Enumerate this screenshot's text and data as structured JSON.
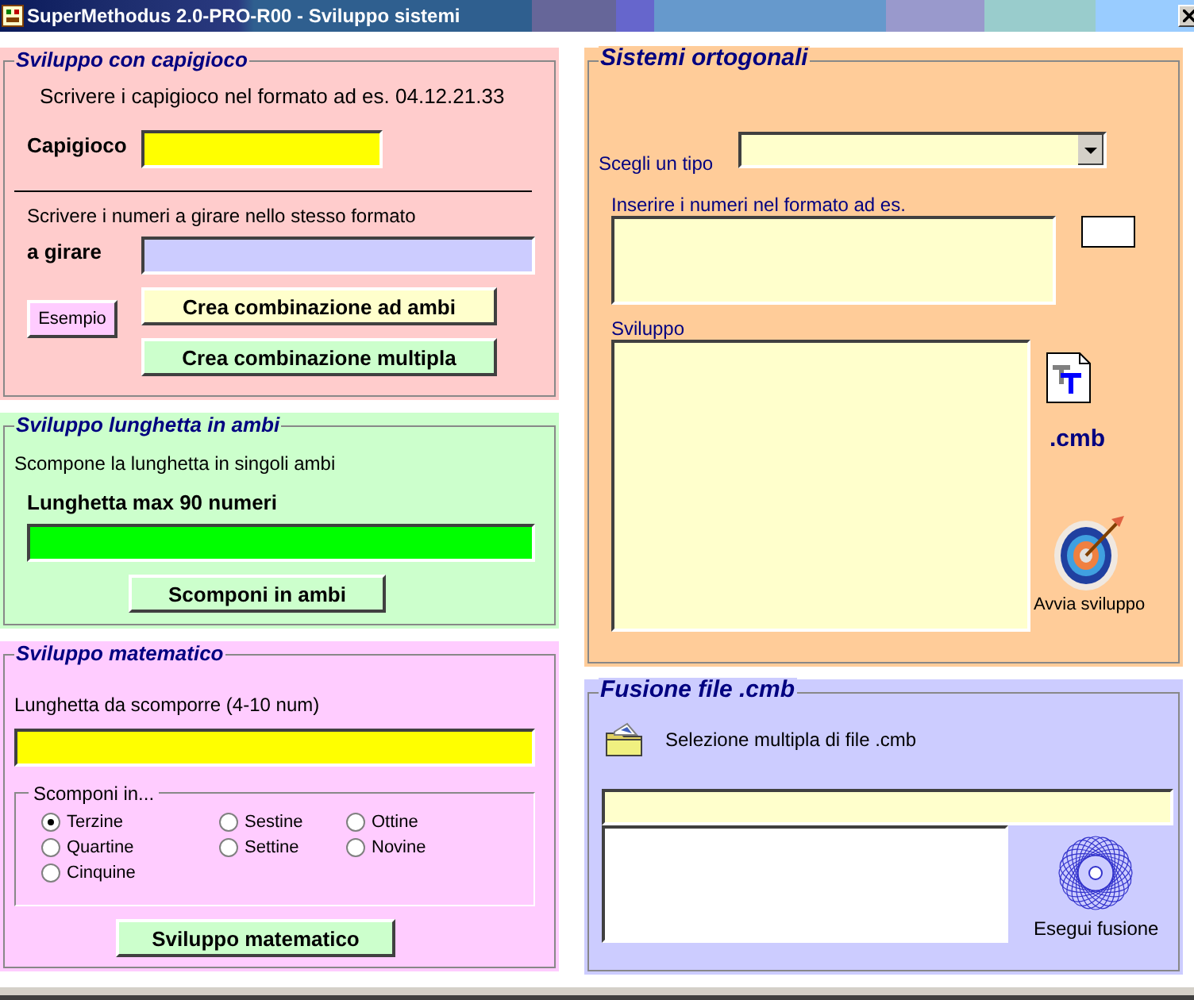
{
  "window": {
    "title": "SuperMethodus 2.0-PRO-R00 - Sviluppo sistemi"
  },
  "capigioco": {
    "title": "Sviluppo con capigioco",
    "instruction": "Scrivere i capigioco nel formato ad es. 04.12.21.33",
    "capigioco_label": "Capigioco",
    "numbers_instruction": "Scrivere i numeri a girare nello stesso formato",
    "numbers_label": "a girare",
    "example_button": "Esempio",
    "ambi_button": "Crea combinazione ad ambi",
    "multipla_button": "Crea combinazione multipla"
  },
  "lunghetta": {
    "title": "Sviluppo lunghetta in ambi",
    "description": "Scompone la lunghetta in singoli ambi",
    "max_label": "Lunghetta max 90 numeri",
    "button": "Scomponi in ambi"
  },
  "matematico": {
    "title": "Sviluppo matematico",
    "length_label": "Lunghetta da scomporre (4-10 num)",
    "group_title": "Scomponi in...",
    "option_columns": [
      [
        {
          "label": "Terzine",
          "selected": true
        },
        {
          "label": "Quartine",
          "selected": false
        },
        {
          "label": "Cinquine",
          "selected": false
        }
      ],
      [
        {
          "label": "Sestine",
          "selected": false
        },
        {
          "label": "Settine",
          "selected": false
        }
      ],
      [
        {
          "label": "Ottine",
          "selected": false
        },
        {
          "label": "Novine",
          "selected": false
        }
      ]
    ],
    "button": "Sviluppo matematico"
  },
  "ortogonali": {
    "title": "Sistemi ortogonali",
    "type_label": "Scegli un tipo",
    "numbers_label": "Inserire i numeri nel formato ad es.",
    "development_label": "Sviluppo",
    "extension_label": ".cmb",
    "run_label": "Avvia sviluppo"
  },
  "fusione": {
    "title": "Fusione file .cmb",
    "select_label": "Selezione multipla di file .cmb",
    "run_label": "Esegui fusione"
  }
}
